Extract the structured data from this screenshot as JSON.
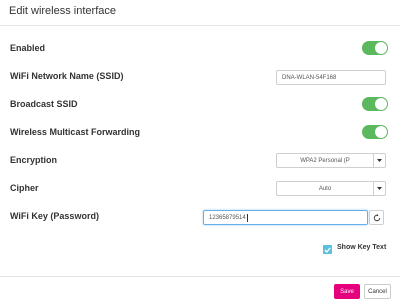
{
  "dialog": {
    "title": "Edit wireless interface"
  },
  "fields": {
    "enabled": {
      "label": "Enabled",
      "on": true
    },
    "ssid": {
      "label": "WiFi Network Name (SSID)",
      "value": "DNA-WLAN-54F168"
    },
    "broadcast_ssid": {
      "label": "Broadcast SSID",
      "on": true
    },
    "multicast": {
      "label": "Wireless Multicast Forwarding",
      "on": true
    },
    "encryption": {
      "label": "Encryption",
      "value": "WPA2 Personal (P"
    },
    "cipher": {
      "label": "Cipher",
      "value": "Auto"
    },
    "wifi_key": {
      "label": "WiFi Key (Password)",
      "value": "12365879514"
    },
    "show_key": {
      "label": "Show Key Text",
      "checked": true
    }
  },
  "footer": {
    "save_label": "Save",
    "cancel_label": "Cancel"
  },
  "icons": {
    "toggle": "toggle-switch",
    "dropdown": "chevron-down-icon",
    "reset": "refresh-icon",
    "check": "checkmark-icon"
  },
  "colors": {
    "toggle_on": "#5cb85c",
    "save_button": "#e6007e",
    "checkbox": "#5bc0de",
    "focus_border": "#66afe9"
  }
}
